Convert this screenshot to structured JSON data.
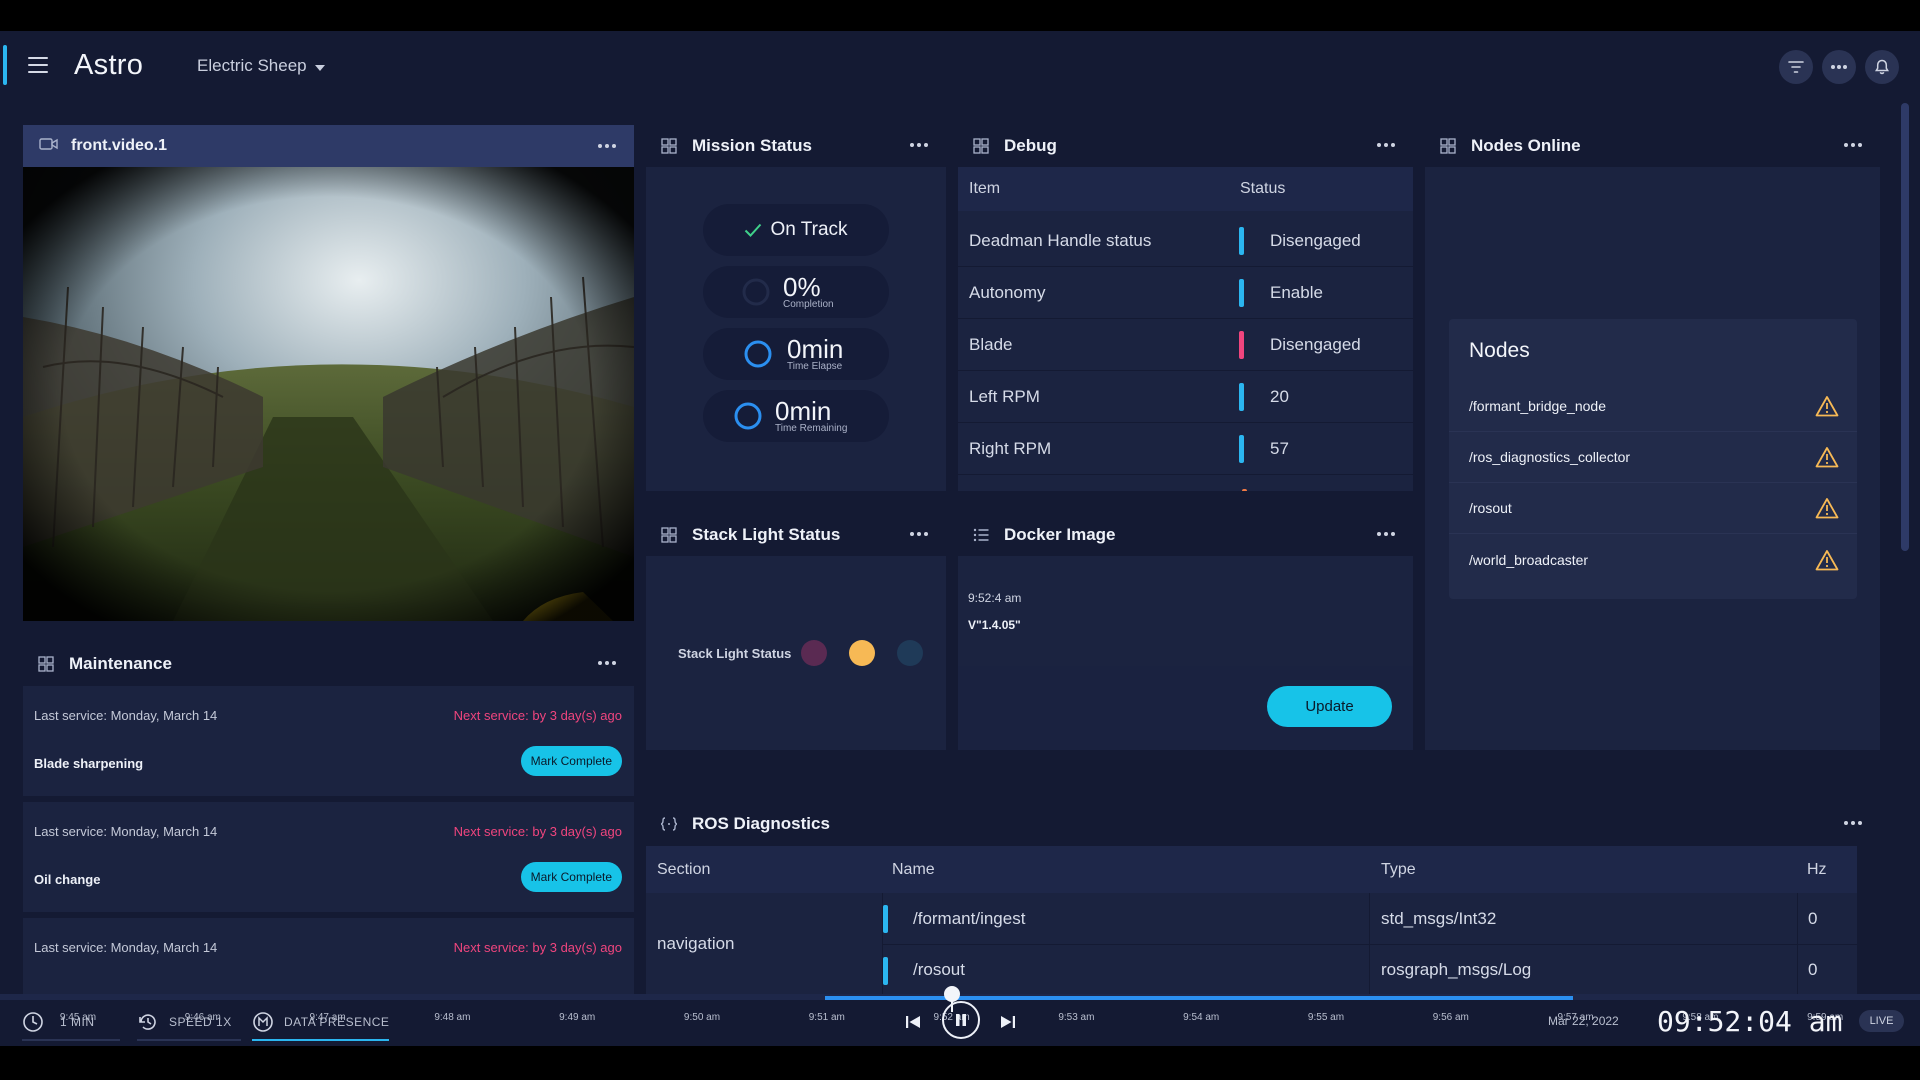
{
  "header": {
    "app_title": "Astro",
    "robot_name": "Electric Sheep",
    "icons": [
      "menu-icon",
      "filter-icon",
      "more-icon",
      "bell-icon"
    ]
  },
  "video": {
    "title": "front.video.1"
  },
  "mission_status": {
    "title": "Mission Status",
    "status": "On Track",
    "completion_value": "0%",
    "completion_label": "Completion",
    "elapsed_value": "0min",
    "elapsed_label": "Time Elapse",
    "remaining_value": "0min",
    "remaining_label": "Time Remaining"
  },
  "debug": {
    "title": "Debug",
    "columns": [
      "Item",
      "Status"
    ],
    "rows": [
      {
        "item": "Deadman Handle status",
        "status": "Disengaged",
        "color": "#2bb6f0"
      },
      {
        "item": "Autonomy",
        "status": "Enable",
        "color": "#2bb6f0"
      },
      {
        "item": "Blade",
        "status": "Disengaged",
        "color": "#f0457e"
      },
      {
        "item": "Left RPM",
        "status": "20",
        "color": "#2bb6f0"
      },
      {
        "item": "Right RPM",
        "status": "57",
        "color": "#2bb6f0"
      }
    ]
  },
  "nodes_online": {
    "title": "Nodes Online",
    "card_title": "Nodes",
    "nodes": [
      "/formant_bridge_node",
      "/ros_diagnostics_collector",
      "/rosout",
      "/world_broadcaster"
    ]
  },
  "stack_light": {
    "title": "Stack Light Status",
    "label": "Stack Light Status",
    "lights": [
      "#5a2a52",
      "#f7b955",
      "#1f3a58"
    ]
  },
  "docker": {
    "title": "Docker Image",
    "timestamp": "9:52:4 am",
    "version": "V\"1.4.05\"",
    "update_label": "Update"
  },
  "maintenance": {
    "title": "Maintenance",
    "items": [
      {
        "last": "Last service: Monday, March 14",
        "next": "Next service: by 3 day(s) ago",
        "task": "Blade sharpening",
        "action": "Mark Complete"
      },
      {
        "last": "Last service: Monday, March 14",
        "next": "Next service: by 3 day(s) ago",
        "task": "Oil change",
        "action": "Mark Complete"
      },
      {
        "last": "Last service: Monday, March 14",
        "next": "Next service: by 3 day(s) ago",
        "task": "",
        "action": ""
      }
    ]
  },
  "ros_diagnostics": {
    "title": "ROS Diagnostics",
    "columns": [
      "Section",
      "Name",
      "Type",
      "Hz"
    ],
    "section": "navigation",
    "rows": [
      {
        "name": "/formant/ingest",
        "type": "std_msgs/Int32",
        "hz": "0"
      },
      {
        "name": "/rosout",
        "type": "rosgraph_msgs/Log",
        "hz": "0"
      }
    ]
  },
  "timeline": {
    "ticks": [
      "9:45 am",
      "9:46 am",
      "9:47 am",
      "9:48 am",
      "9:49 am",
      "9:50 am",
      "9:51 am",
      "9:52 am",
      "9:53 am",
      "9:54 am",
      "9:55 am",
      "9:56 am",
      "9:57 am",
      "9:58 am",
      "9:59 am"
    ],
    "scrub_position": 0.5,
    "window_label": "1 MIN",
    "speed_label": "SPEED 1X",
    "presence_label": "DATA PRESENCE",
    "date": "Mar 22, 2022",
    "time": "09:52:04 am",
    "live_label": "LIVE"
  },
  "colors": {
    "accent": "#17c3e8",
    "alert": "#f0457e",
    "warning": "#f7b955"
  }
}
